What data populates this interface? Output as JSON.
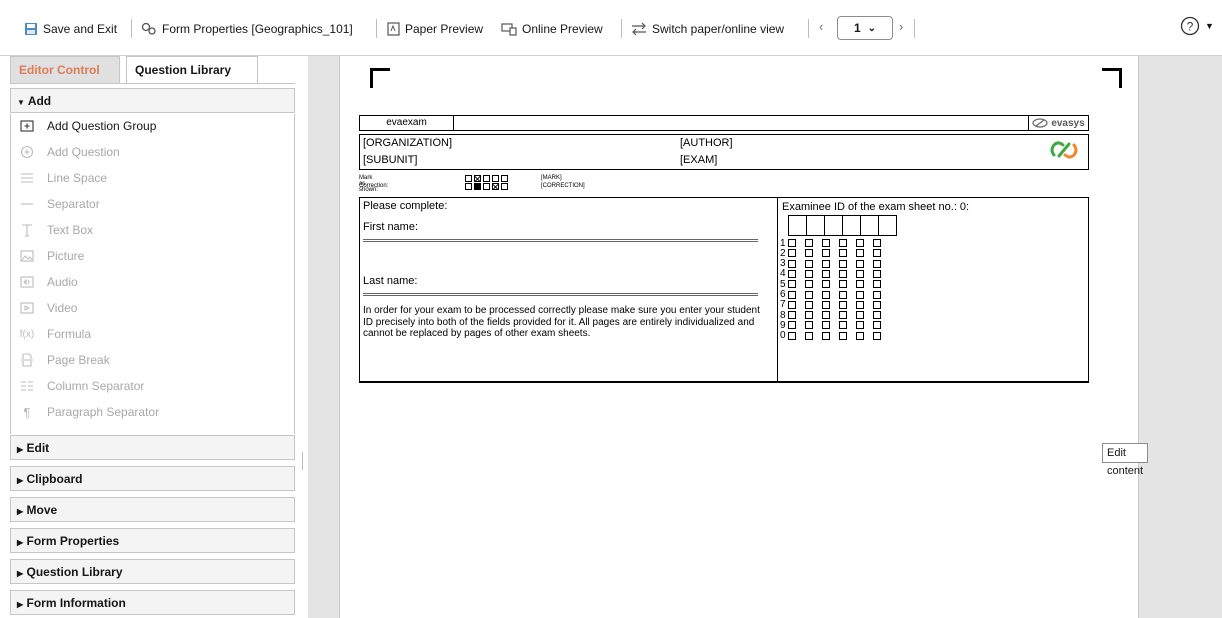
{
  "toolbar": {
    "save_exit": "Save and Exit",
    "form_properties": "Form Properties [Geographics_101]",
    "paper_preview": "Paper Preview",
    "online_preview": "Online Preview",
    "switch_view": "Switch paper/online view",
    "page_number": "1",
    "prev_icon": "chevron-left-icon",
    "next_icon": "chevron-right-icon",
    "help_icon": "help-icon"
  },
  "sidebar": {
    "tabs": [
      "Editor Control",
      "Question Library"
    ],
    "add_header": "Add",
    "add_items": [
      {
        "label": "Add Question Group",
        "icon": "add-group-icon",
        "enabled": true
      },
      {
        "label": "Add Question",
        "icon": "add-question-icon",
        "enabled": false
      },
      {
        "label": "Line Space",
        "icon": "line-space-icon",
        "enabled": false
      },
      {
        "label": "Separator",
        "icon": "separator-icon",
        "enabled": false
      },
      {
        "label": "Text Box",
        "icon": "text-box-icon",
        "enabled": false
      },
      {
        "label": "Picture",
        "icon": "picture-icon",
        "enabled": false
      },
      {
        "label": "Audio",
        "icon": "audio-icon",
        "enabled": false
      },
      {
        "label": "Video",
        "icon": "video-icon",
        "enabled": false
      },
      {
        "label": "Formula",
        "icon": "formula-icon",
        "enabled": false
      },
      {
        "label": "Page Break",
        "icon": "page-break-icon",
        "enabled": false
      },
      {
        "label": "Column Separator",
        "icon": "column-separator-icon",
        "enabled": false
      },
      {
        "label": "Paragraph Separator",
        "icon": "paragraph-separator-icon",
        "enabled": false
      }
    ],
    "collapsed_sections": [
      "Edit",
      "Clipboard",
      "Move",
      "Form Properties",
      "Question Library",
      "Form Information"
    ]
  },
  "form": {
    "header_name": "evaexam",
    "logo_text": "evasys",
    "organization": "[ORGANIZATION]",
    "subunit": "[SUBUNIT]",
    "author": "[AUTHOR]",
    "exam": "[EXAM]",
    "mark_label": "Mark as shown:",
    "mark_tag": "[MARK]",
    "correction_label": "Correction:",
    "correction_tag": "[CORRECTION]",
    "please_complete": "Please complete:",
    "first_name": "First name:",
    "last_name": "Last name:",
    "instructions": "In order for your exam to be processed correctly please make sure you enter your student ID precisely into both of the fields provided for it. All pages are entirely individualized and cannot be replaced by pages of other exam sheets.",
    "examinee_id": "Examinee ID of the exam sheet no.: 0:",
    "digits": [
      "1",
      "2",
      "3",
      "4",
      "5",
      "6",
      "7",
      "8",
      "9",
      "0"
    ],
    "id_columns": 6
  },
  "edit_content": "Edit content",
  "colors": {
    "accent_tab": "#e07b56",
    "logo_green": "#3ea93e",
    "logo_orange": "#f0892b"
  }
}
